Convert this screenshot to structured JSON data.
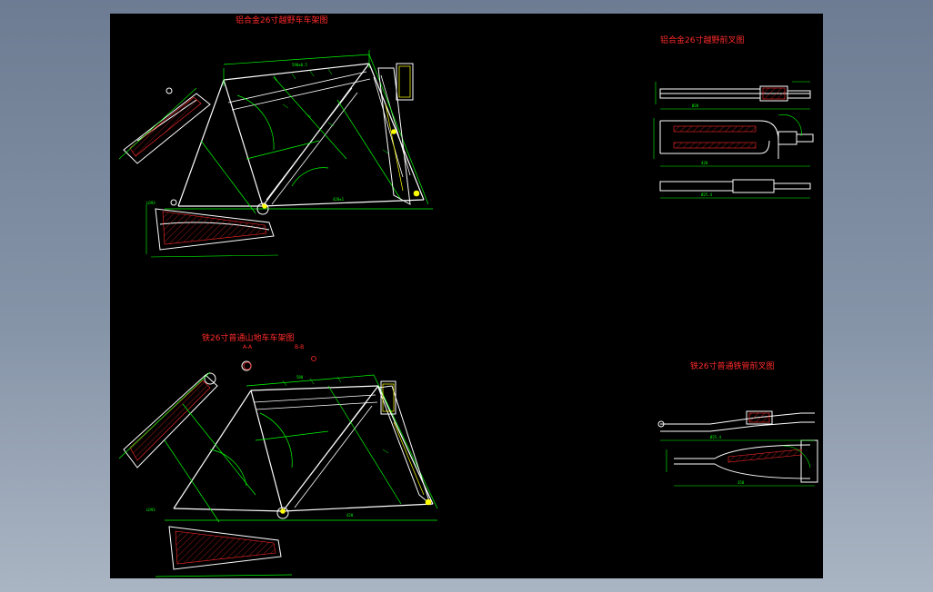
{
  "drawing": {
    "titles": {
      "alloy_frame": "铝合金26寸越野车车架图",
      "alloy_fork": "铝合金26寸越野前叉图",
      "iron_frame": "铁26寸普通山地车车架图",
      "iron_fork": "铁26寸普通铁管前叉图"
    },
    "section_marks": {
      "a": "A-A",
      "b": "B-B"
    }
  },
  "colors": {
    "background_gradient_top": "#6d7c92",
    "background_gradient_bottom": "#aab5c3",
    "canvas": "#000000",
    "geometry": "#ffffff",
    "dimension": "#00ff00",
    "hatch": "#ff2a2a",
    "highlight": "#ffff00",
    "title_text": "#ff2a2a"
  }
}
